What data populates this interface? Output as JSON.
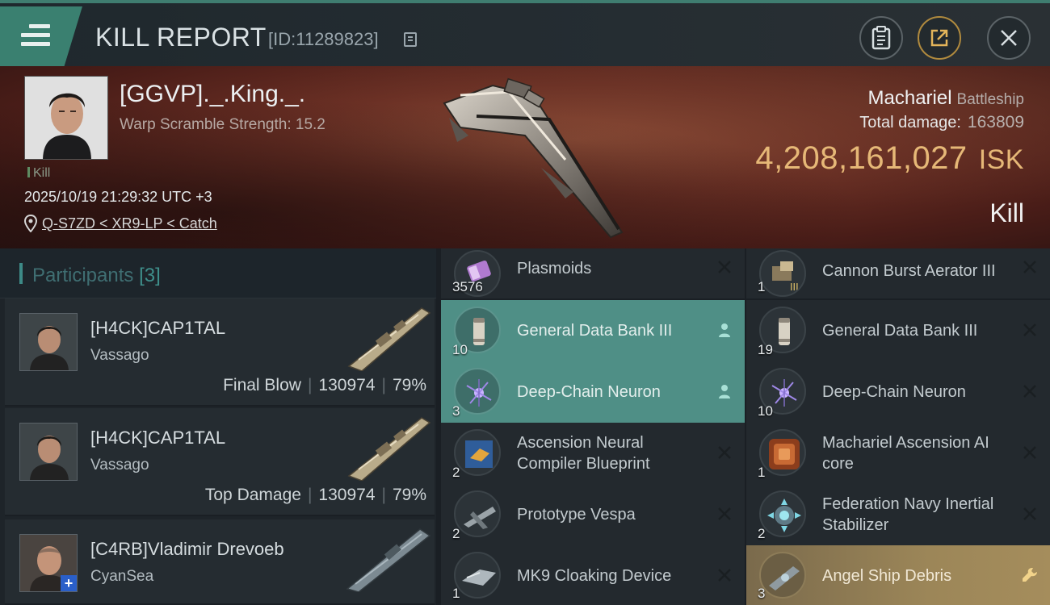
{
  "header": {
    "title": "KILL REPORT",
    "report_id": "[ID:11289823]"
  },
  "victim": {
    "name": "[GGVP]._.King._.",
    "scramble": "Warp Scramble Strength: 15.2",
    "tag": "Kill",
    "timestamp": "2025/10/19 21:29:32 UTC +3",
    "location": "Q-S7ZD < XR9-LP < Catch"
  },
  "ship": {
    "name": "Machariel",
    "class": "Battleship",
    "total_damage_label": "Total damage:",
    "total_damage": "163809",
    "isk_value": "4,208,161,027",
    "isk_unit": "ISK",
    "result": "Kill"
  },
  "participants": {
    "label": "Participants",
    "count": "[3]",
    "rows": [
      {
        "name": "[H4CK]CAP1TAL",
        "ship": "Vassago",
        "role": "Final Blow",
        "damage": "130974",
        "percent": "79%"
      },
      {
        "name": "[H4CK]CAP1TAL",
        "ship": "Vassago",
        "role": "Top Damage",
        "damage": "130974",
        "percent": "79%"
      },
      {
        "name": "[C4RB]Vladimir Drevoeb",
        "ship": "CyanSea",
        "role": "",
        "damage": "",
        "percent": ""
      }
    ]
  },
  "items": {
    "left": [
      {
        "qty": "3576",
        "name": "Plasmoids",
        "status": "destroyed",
        "icon": "plasmoid-icon"
      },
      {
        "qty": "10",
        "name": "General Data Bank III",
        "status": "dropped",
        "icon": "data-bank-icon"
      },
      {
        "qty": "3",
        "name": "Deep-Chain Neuron",
        "status": "dropped",
        "icon": "neuron-icon"
      },
      {
        "qty": "2",
        "name": "Ascension Neural Compiler Blueprint",
        "status": "destroyed",
        "icon": "blueprint-icon"
      },
      {
        "qty": "2",
        "name": "Prototype  Vespa",
        "status": "destroyed",
        "icon": "drone-icon"
      },
      {
        "qty": "1",
        "name": "MK9 Cloaking Device",
        "status": "destroyed",
        "icon": "cloak-icon"
      }
    ],
    "right": [
      {
        "qty": "1",
        "name": "Cannon Burst Aerator III",
        "status": "destroyed",
        "icon": "aerator-icon"
      },
      {
        "qty": "19",
        "name": "General Data Bank III",
        "status": "destroyed",
        "icon": "data-bank-icon"
      },
      {
        "qty": "10",
        "name": "Deep-Chain Neuron",
        "status": "destroyed",
        "icon": "neuron-icon"
      },
      {
        "qty": "1",
        "name": "Machariel Ascension AI core",
        "status": "destroyed",
        "icon": "ai-core-icon"
      },
      {
        "qty": "2",
        "name": "Federation Navy Inertial Stabilizer",
        "status": "destroyed",
        "icon": "stabilizer-icon"
      },
      {
        "qty": "3",
        "name": "Angel Ship Debris",
        "status": "salvage",
        "icon": "debris-icon"
      }
    ]
  },
  "colors": {
    "accent": "#3a8070",
    "dropped": "#4f8f86",
    "isk": "#e6b877",
    "salvage": "#a58d5c"
  }
}
